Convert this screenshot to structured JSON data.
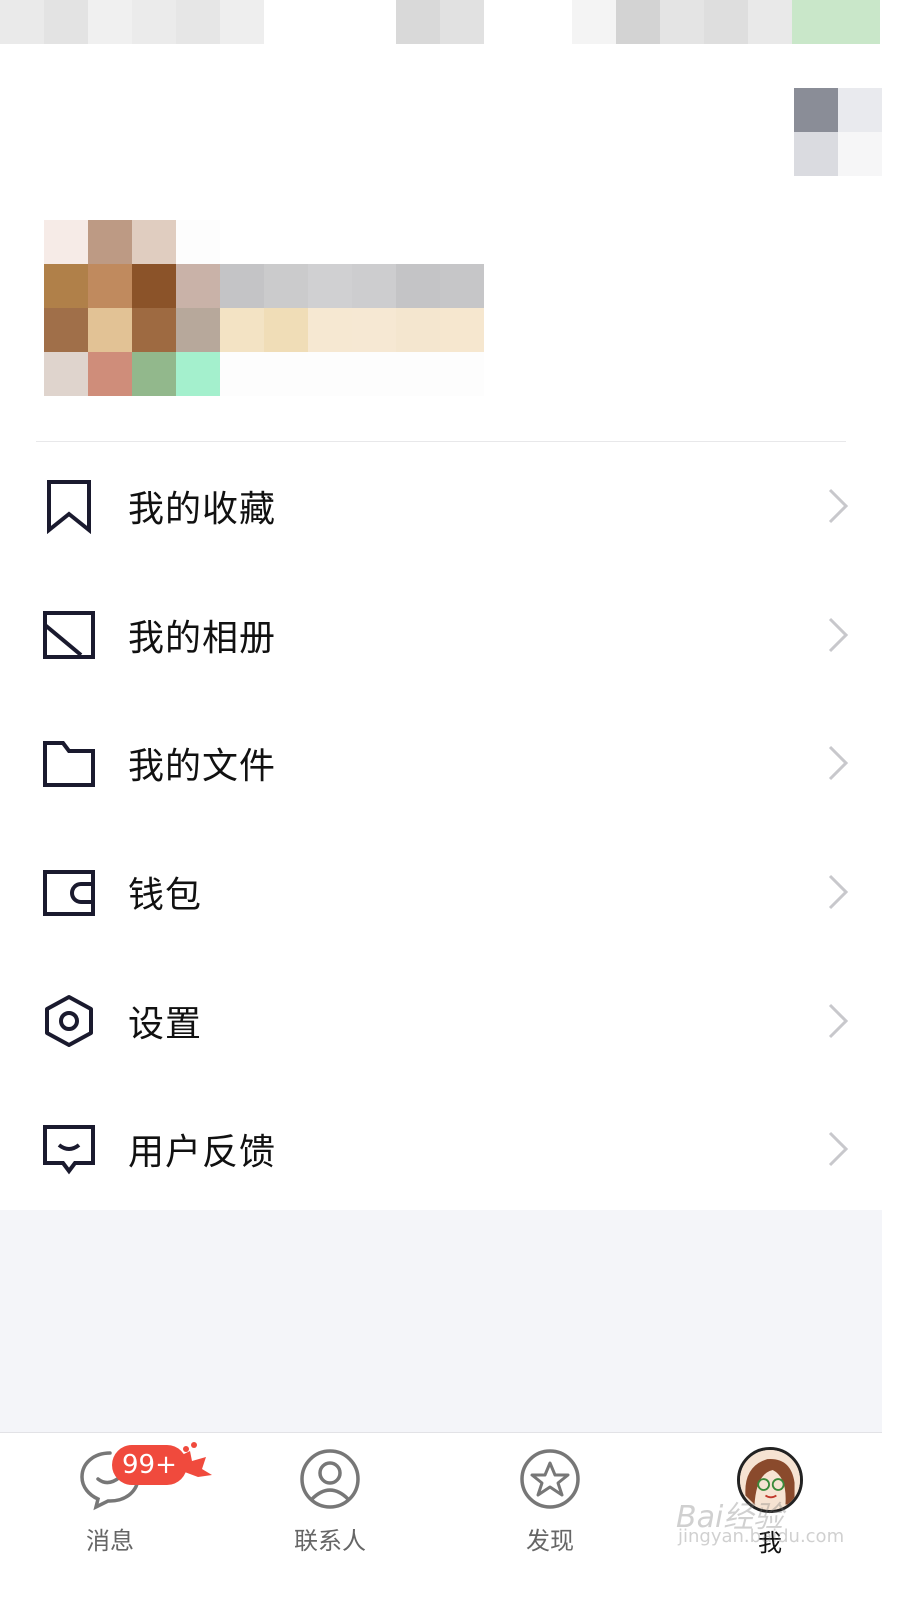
{
  "status_mosaic_colors": [
    "#eaeaea",
    "#e3e3e3",
    "#f0f0f0",
    "#ebebeb",
    "#e6e6e6",
    "#eeeeee",
    "#ffffff",
    "#ffffff",
    "#ffffff",
    "#d9d9d9",
    "#e1e1e1",
    "#ffffff",
    "#ffffff",
    "#f4f4f4",
    "#d3d3d3",
    "#e4e4e4",
    "#dedede",
    "#e9e9e9",
    "#c9e7c9",
    "#c9e7c9"
  ],
  "qr_mosaic_colors": [
    "#8a8d97",
    "#e9eaee",
    "#dadbe0",
    "#f6f6f7"
  ],
  "profile_mosaic_colors": [
    "#f6ebe7",
    "#bd9a84",
    "#e0cdc0",
    "#fdfdfd",
    "#ffffff",
    "#ffffff",
    "#ffffff",
    "#ffffff",
    "#ffffff",
    "#ffffff",
    "#b08049",
    "#c08a5e",
    "#8b5329",
    "#c9b2a8",
    "#c4c4c6",
    "#cbcbcc",
    "#d0d0d2",
    "#cdcdcf",
    "#c4c4c6",
    "#c6c6c8",
    "#a06f49",
    "#e2c295",
    "#9e6a41",
    "#b7a89b",
    "#f3e3c4",
    "#f0ddb7",
    "#f6e8d2",
    "#f6e8d3",
    "#f4e6cf",
    "#f6e7cf",
    "#dfd4cd",
    "#cf8d7a",
    "#92b88c",
    "#a4f0cd",
    "#fdfdfd",
    "#fdfdfd",
    "#fdfdfd",
    "#fdfdfd",
    "#fdfdfd",
    "#fdfdfd"
  ],
  "menu": [
    {
      "label": "我的收藏",
      "icon": "bookmark-icon"
    },
    {
      "label": "我的相册",
      "icon": "photo-album-icon"
    },
    {
      "label": "我的文件",
      "icon": "folder-icon"
    },
    {
      "label": "钱包",
      "icon": "wallet-icon"
    },
    {
      "label": "设置",
      "icon": "settings-hexagon-icon"
    },
    {
      "label": "用户反馈",
      "icon": "feedback-icon"
    }
  ],
  "tabbar": {
    "tabs": [
      {
        "label": "消息",
        "icon": "message-bubble-icon"
      },
      {
        "label": "联系人",
        "icon": "contacts-icon"
      },
      {
        "label": "发现",
        "icon": "discover-star-icon"
      },
      {
        "label": "我",
        "icon": "profile-avatar-icon"
      }
    ],
    "badge": "99+"
  },
  "watermark": {
    "main": "Bai经验",
    "sub": "jingyan.baidu.com"
  },
  "colors": {
    "accent_badge": "#f04a3d",
    "icon_stroke": "#1a1a2e",
    "chevron": "#c8c8cc",
    "background_gray": "#f4f5f9"
  }
}
